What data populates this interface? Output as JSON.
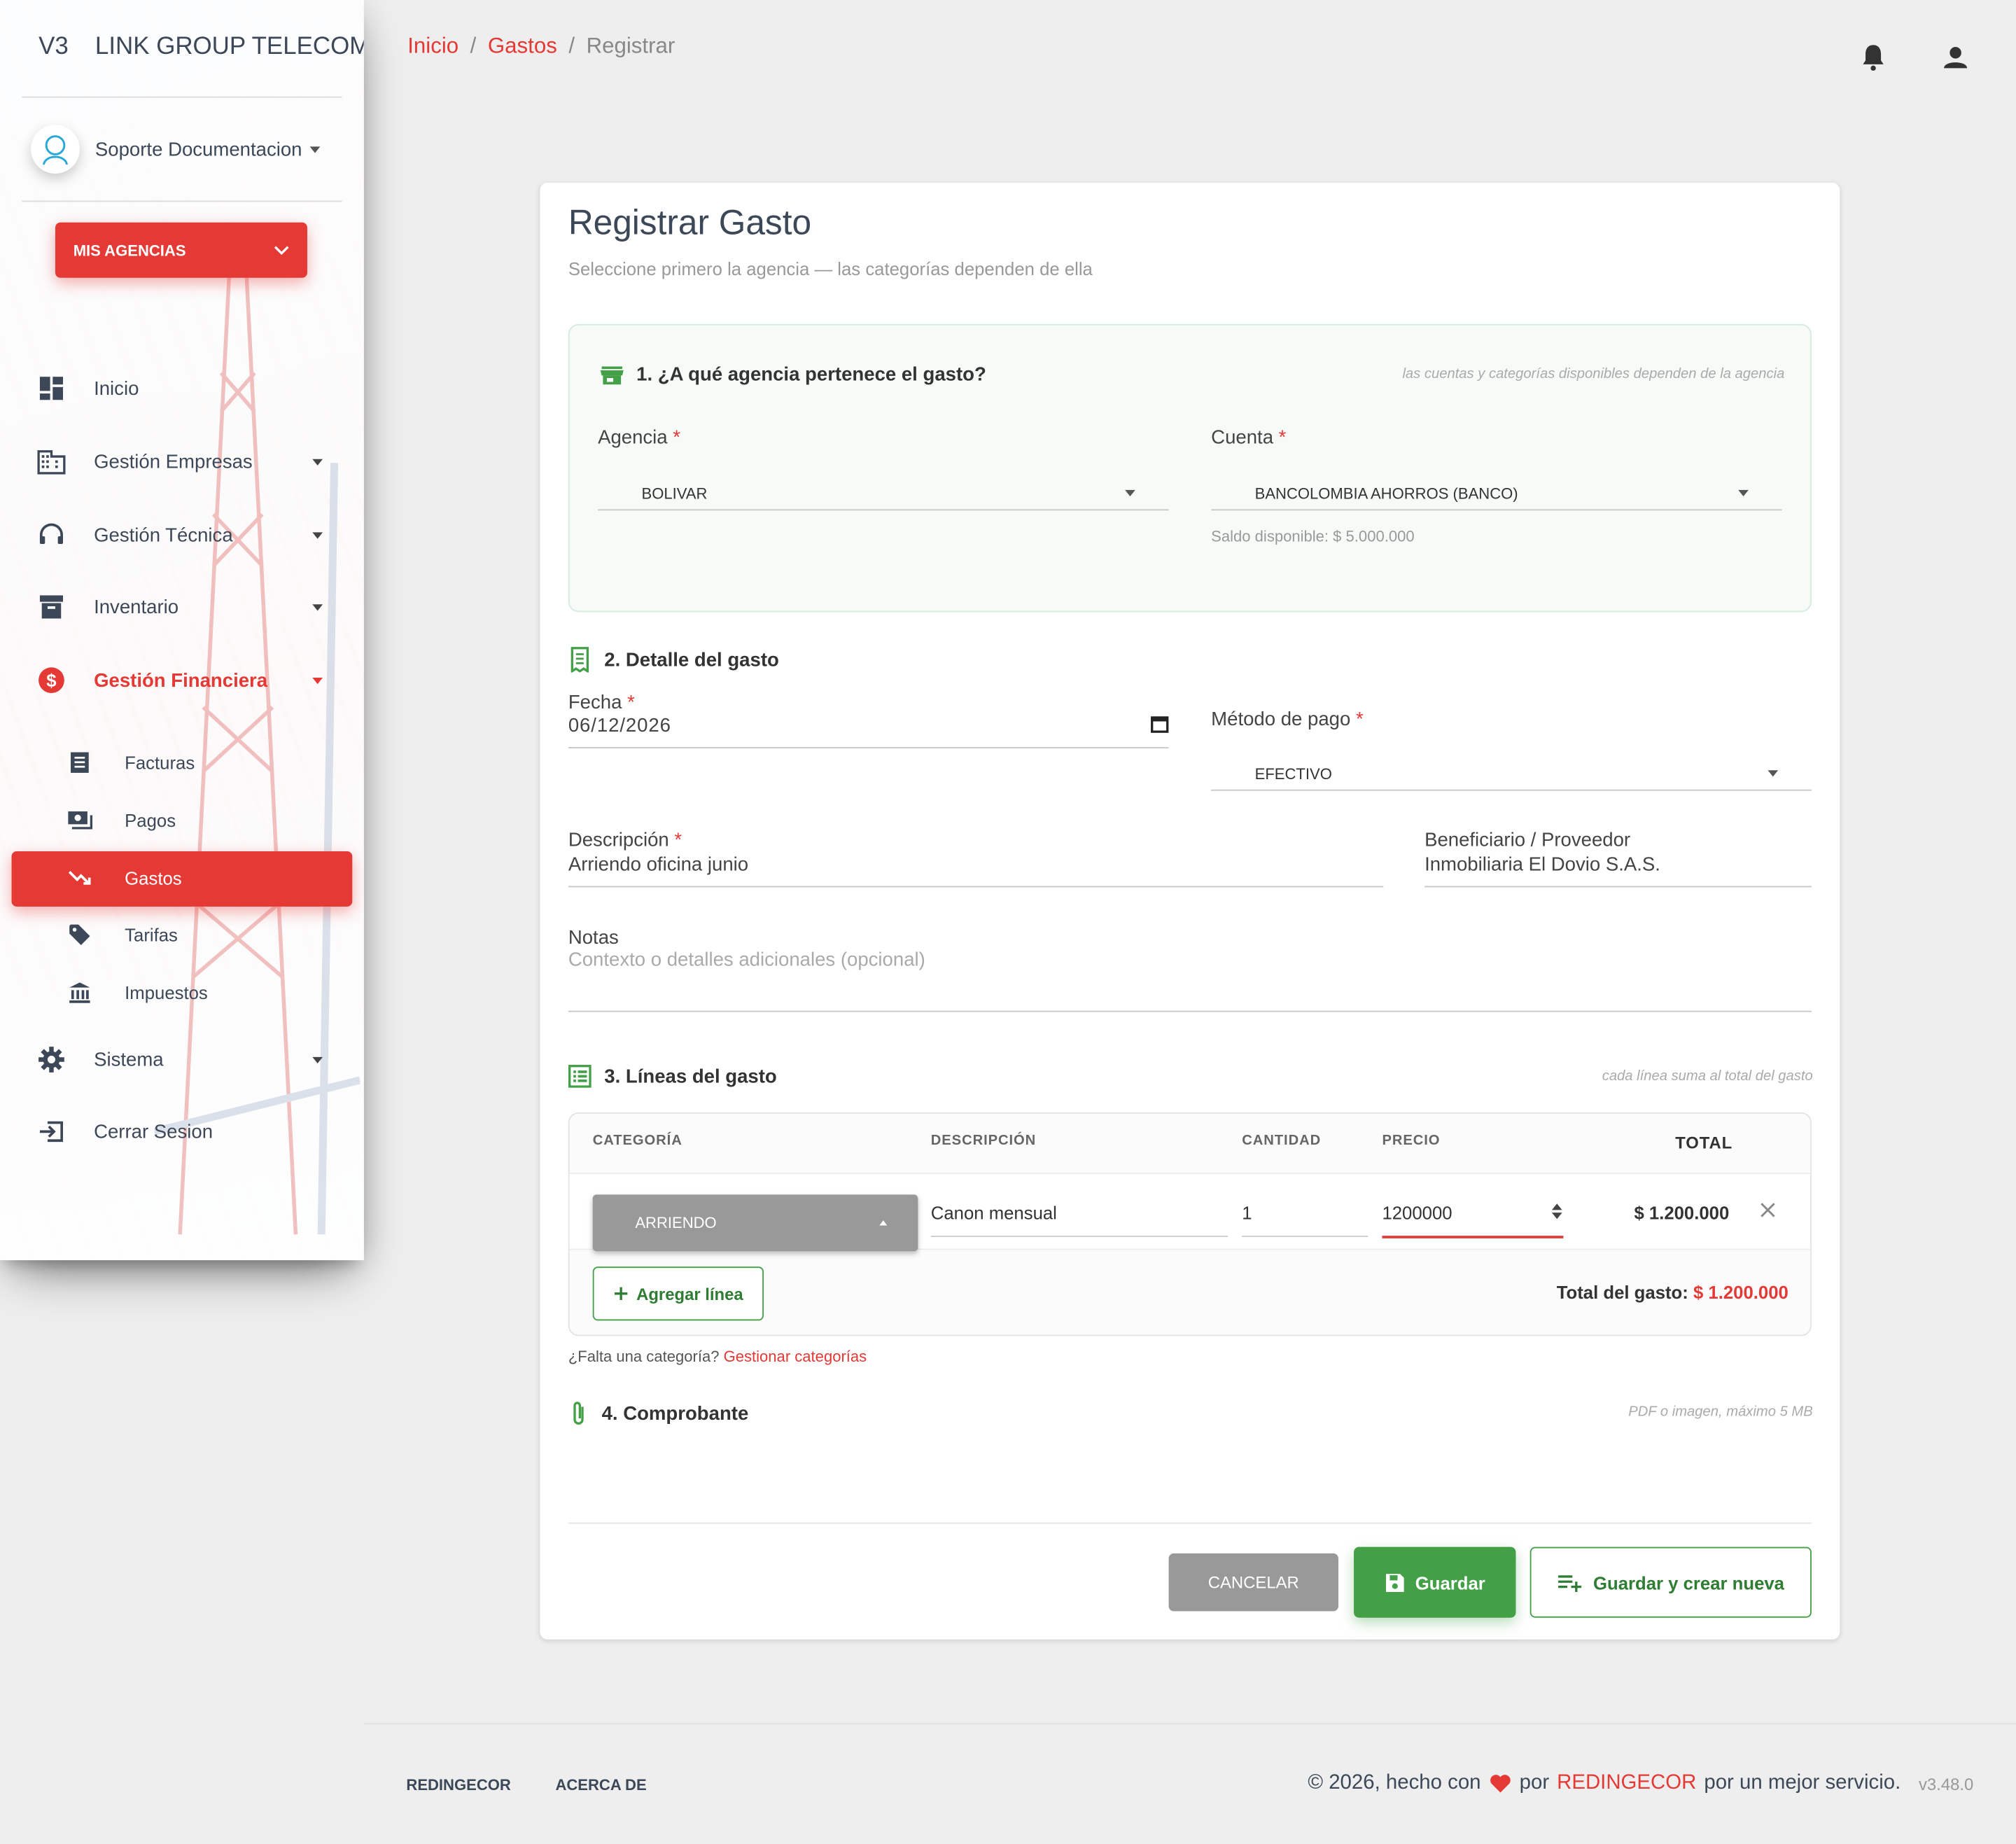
{
  "app": {
    "mini_brand": "V3",
    "brand": "LINK GROUP TELECOMUNICACIONES"
  },
  "user": {
    "name": "Soporte Documentacion"
  },
  "agencies_button": "MIS AGENCIAS",
  "nav": {
    "inicio": "Inicio",
    "empresas": "Gestión Empresas",
    "tecnica": "Gestión Técnica",
    "inventario": "Inventario",
    "financiera": "Gestión Financiera",
    "facturas": "Facturas",
    "pagos": "Pagos",
    "gastos": "Gastos",
    "tarifas": "Tarifas",
    "impuestos": "Impuestos",
    "sistema": "Sistema",
    "logout": "Cerrar Sesion"
  },
  "breadcrumb": {
    "home": "Inicio",
    "sep": "/",
    "section": "Gastos",
    "current": "Registrar"
  },
  "page": {
    "title": "Registrar Gasto",
    "subtitle": "Seleccione primero la agencia — las categorías dependen de ella"
  },
  "section1": {
    "title": "1. ¿A qué agencia pertenece el gasto?",
    "hint": "las cuentas y categorías disponibles dependen de la agencia",
    "agency_label": "Agencia",
    "agency_value": "BOLIVAR",
    "account_label": "Cuenta",
    "account_value": "BANCOLOMBIA AHORROS (BANCO)",
    "balance": "Saldo disponible: $ 5.000.000",
    "required_mark": "*"
  },
  "section2": {
    "title": "2. Detalle del gasto",
    "date_label": "Fecha",
    "date_value": "06/12/2026",
    "payment_label": "Método de pago",
    "payment_value": "EFECTIVO",
    "desc_label": "Descripción",
    "desc_value": "Arriendo oficina junio",
    "beneficiary_label": "Beneficiario / Proveedor",
    "beneficiary_value": "Inmobiliaria El Dovio S.A.S.",
    "notes_label": "Notas",
    "notes_placeholder": "Contexto o detalles adicionales (opcional)"
  },
  "section3": {
    "title": "3. Líneas del gasto",
    "hint": "cada línea suma al total del gasto",
    "columns": {
      "category": "CATEGORÍA",
      "description": "DESCRIPCIÓN",
      "quantity": "CANTIDAD",
      "price": "PRECIO",
      "total": "TOTAL"
    },
    "rows": [
      {
        "category": "ARRIENDO",
        "description": "Canon mensual",
        "quantity": "1",
        "price": "1200000",
        "total": "$ 1.200.000"
      }
    ],
    "add_line": "Agregar línea",
    "total_label": "Total del gasto:",
    "total_value": "$ 1.200.000",
    "missing_category": "¿Falta una categoría?",
    "manage_categories": "Gestionar categorías"
  },
  "section4": {
    "title": "4. Comprobante",
    "hint": "PDF o imagen, máximo 5 MB"
  },
  "actions": {
    "cancel": "CANCELAR",
    "save": "Guardar",
    "save_new": "Guardar y crear nueva"
  },
  "footer": {
    "link1": "REDINGECOR",
    "link2": "ACERCA DE",
    "copyright_prefix": "© 2026, hecho con",
    "copyright_by": "por",
    "company": "REDINGECOR",
    "copyright_suffix": "por un mejor servicio.",
    "version": "v3.48.0"
  },
  "colors": {
    "accent": "#e53935",
    "success": "#43a047",
    "muted_button": "#999999"
  }
}
